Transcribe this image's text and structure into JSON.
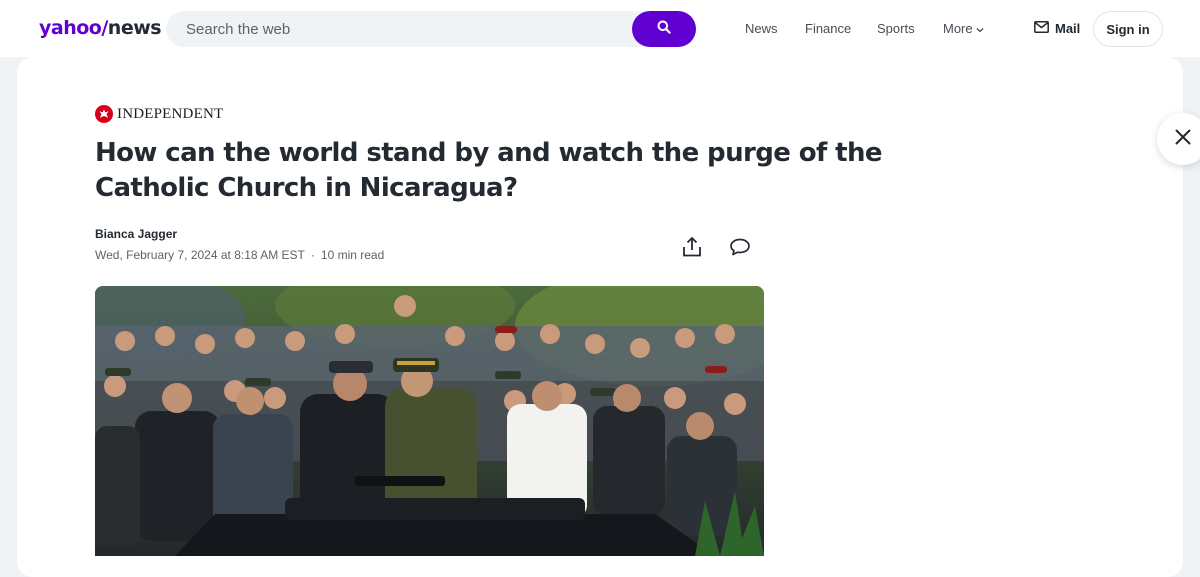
{
  "header": {
    "logo_text": "yahoo",
    "logo_slash": "/",
    "logo_section": "news",
    "search": {
      "placeholder": "Search the web",
      "value": "",
      "button_icon": "search-icon"
    },
    "nav": {
      "news": "News",
      "finance": "Finance",
      "sports": "Sports",
      "more": "More"
    },
    "mail_label": "Mail",
    "signin_label": "Sign in"
  },
  "article": {
    "publisher": "INDEPENDENT",
    "headline": "How can the world stand by and watch the purge of the Catholic Church in Nicaragua?",
    "author": "Bianca Jagger",
    "date": "Wed, February 7, 2024 at 8:18 AM EST",
    "separator": "·",
    "read_time": "10 min read",
    "actions": {
      "share_icon": "share-icon",
      "comment_icon": "comment-icon"
    },
    "hero_image": {
      "description_icon": "photo"
    }
  },
  "colors": {
    "brand": "#6001d2",
    "text": "#232a31",
    "muted": "#5b636a",
    "publisher_red": "#d6001c",
    "page_bg": "#f0f3f5"
  },
  "close_icon": "close-icon"
}
